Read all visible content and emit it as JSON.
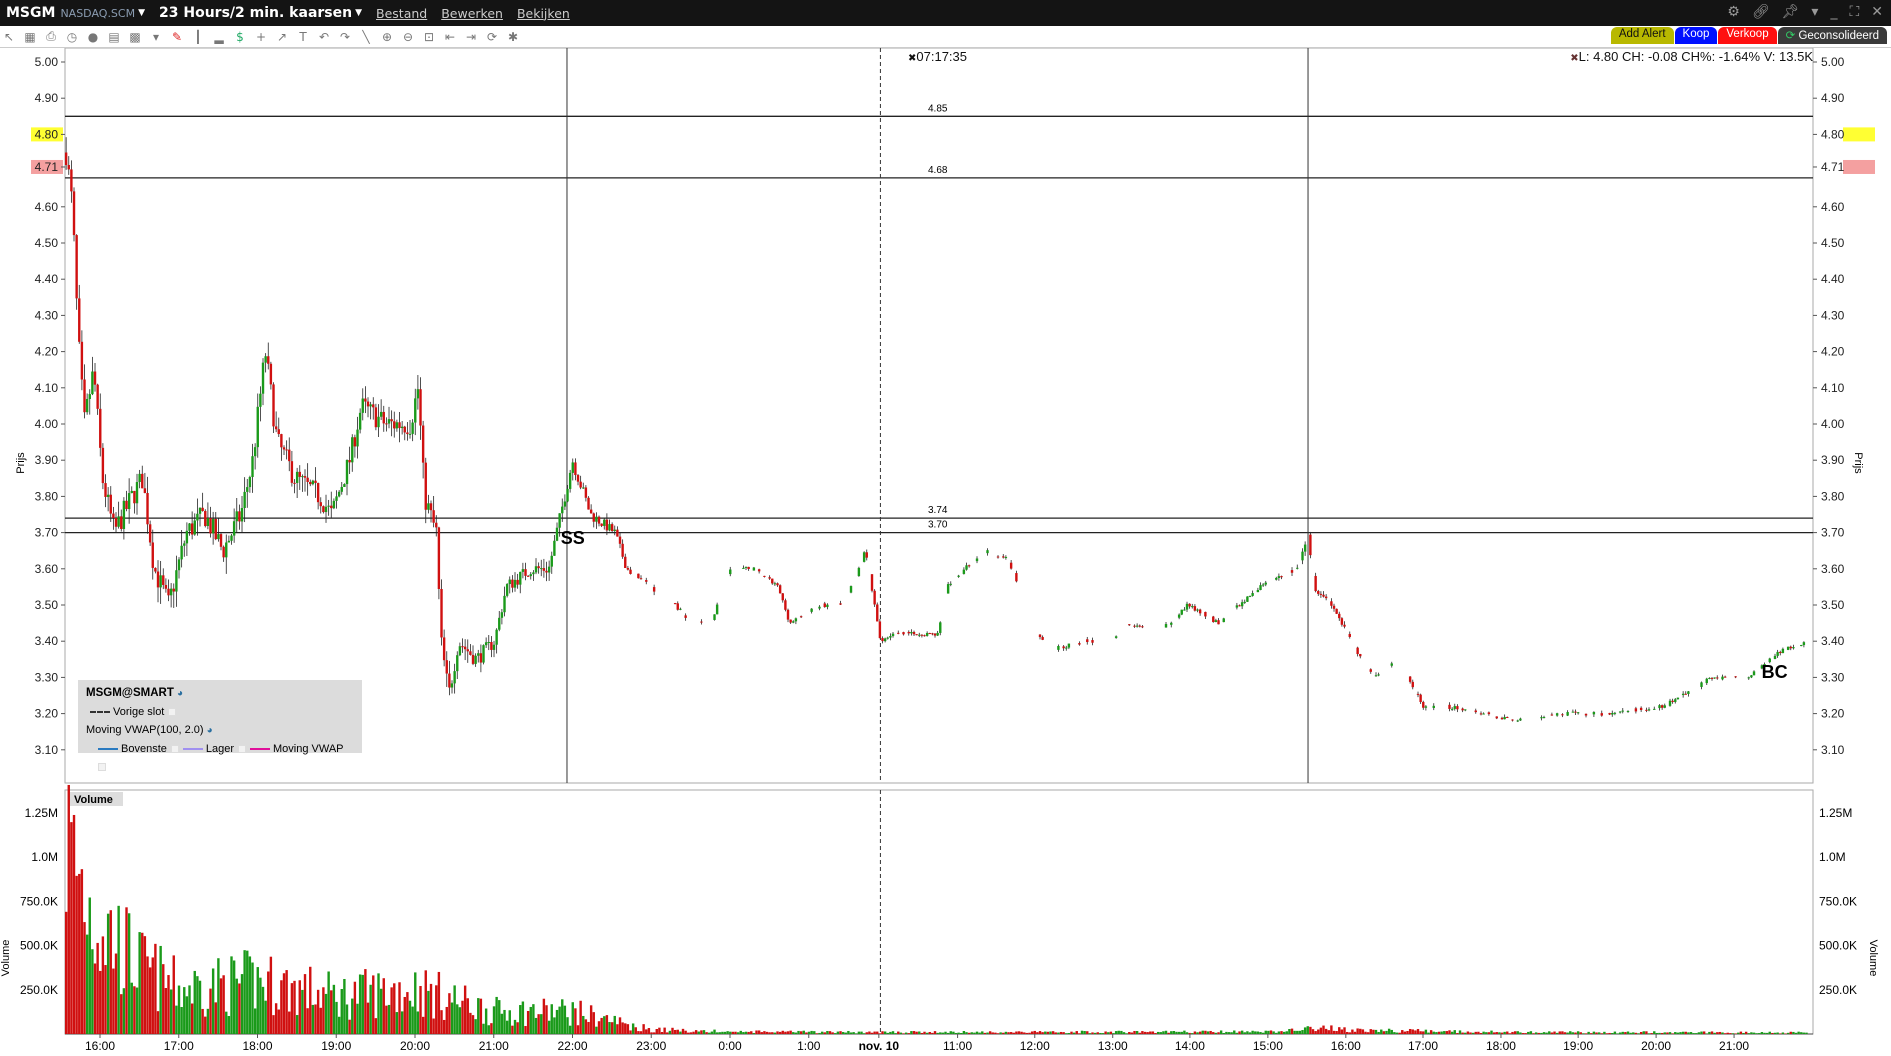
{
  "title_bar": {
    "symbol": "MSGM",
    "exchange": "NASDAQ.SCM",
    "period": "23 Hours/2 min. kaarsen",
    "menus": [
      "Bestand",
      "Bewerken",
      "Bekijken"
    ]
  },
  "actions": {
    "alert": "Add Alert",
    "buy": "Koop",
    "sell": "Verkoop",
    "consolidated": "Geconsolideerd"
  },
  "info": {
    "crosshair_time": "07:17:35",
    "quote": "L: 4.80 CH: -0.08 CH%: -1.64% V: 13.5K"
  },
  "legend": {
    "title": "MSGM@SMART",
    "prev_close": "Vorige slot",
    "indicator": "Moving VWAP(100, 2.0)",
    "upper": "Bovenste",
    "lower": "Lager",
    "vwap": "Moving VWAP"
  },
  "colors": {
    "up": "#1a9a1a",
    "down": "#d01010",
    "last_price_bg": "#ffff33",
    "prev_price_bg": "#f4a0a0",
    "upper": "#2a7ac0",
    "lower": "#a090f0",
    "vwap": "#e0109a"
  },
  "chart_data": {
    "type": "candlestick",
    "price_axis": {
      "label": "Prijs",
      "ylim": [
        3.05,
        5.03
      ],
      "ticks": [
        "5.00",
        "4.90",
        "4.80",
        "4.71",
        "4.60",
        "4.50",
        "4.40",
        "4.30",
        "4.20",
        "4.10",
        "4.00",
        "3.90",
        "3.80",
        "3.70",
        "3.60",
        "3.50",
        "3.40",
        "3.30",
        "3.20",
        "3.10"
      ],
      "highlight_last": "4.80",
      "highlight_prev": "4.71"
    },
    "volume_axis": {
      "label": "Volume",
      "pane_title": "Volume",
      "ticks": [
        "1.25M",
        "1.0M",
        "750.0K",
        "500.0K",
        "250.0K"
      ],
      "tick_values": [
        1250000,
        1000000,
        750000,
        500000,
        250000
      ],
      "ylim": [
        0,
        1320000
      ]
    },
    "time_axis": {
      "labels": [
        [
          "16:00",
          0
        ],
        [
          "17:00",
          1
        ],
        [
          "18:00",
          2
        ],
        [
          "19:00",
          3
        ],
        [
          "20:00",
          4
        ],
        [
          "21:00",
          5
        ],
        [
          "22:00",
          6
        ],
        [
          "23:00",
          7
        ],
        [
          "0:00",
          8
        ],
        [
          "1:00",
          9
        ],
        [
          "nov. 10",
          9.89
        ],
        [
          "11:00",
          10.89
        ],
        [
          "12:00",
          11.87
        ],
        [
          "13:00",
          12.86
        ],
        [
          "14:00",
          13.84
        ],
        [
          "15:00",
          14.83
        ],
        [
          "16:00",
          15.82
        ],
        [
          "17:00",
          16.8
        ],
        [
          "18:00",
          17.79
        ],
        [
          "19:00",
          18.77
        ],
        [
          "20:00",
          19.76
        ],
        [
          "21:00",
          20.75
        ]
      ],
      "xlim": [
        -0.45,
        21.75
      ]
    },
    "hlines": [
      {
        "value": 4.85,
        "label": "4.85"
      },
      {
        "value": 4.68,
        "label": "4.68"
      },
      {
        "value": 3.74,
        "label": "3.74"
      },
      {
        "value": 3.7,
        "label": "3.70"
      }
    ],
    "vlines": [
      {
        "t": 5.93,
        "style": "solid"
      },
      {
        "t": 9.91,
        "style": "dashed"
      },
      {
        "t": 15.34,
        "style": "solid"
      }
    ],
    "annotations": [
      {
        "text": "SS",
        "t": 5.85,
        "price": 3.69
      },
      {
        "text": "BC",
        "t": 21.1,
        "price": 3.32
      }
    ],
    "price_path": [
      [
        -0.43,
        4.75
      ],
      [
        -0.35,
        4.6
      ],
      [
        -0.28,
        4.25
      ],
      [
        -0.2,
        4.0
      ],
      [
        -0.08,
        4.15
      ],
      [
        0.03,
        3.85
      ],
      [
        0.18,
        3.7
      ],
      [
        0.41,
        3.8
      ],
      [
        0.54,
        3.85
      ],
      [
        0.69,
        3.6
      ],
      [
        0.87,
        3.5
      ],
      [
        1.1,
        3.7
      ],
      [
        1.33,
        3.75
      ],
      [
        1.56,
        3.65
      ],
      [
        1.79,
        3.75
      ],
      [
        1.94,
        3.9
      ],
      [
        2.1,
        4.2
      ],
      [
        2.25,
        3.95
      ],
      [
        2.48,
        3.85
      ],
      [
        2.79,
        3.8
      ],
      [
        2.94,
        3.75
      ],
      [
        3.17,
        3.9
      ],
      [
        3.32,
        4.05
      ],
      [
        3.63,
        4.0
      ],
      [
        3.94,
        4.0
      ],
      [
        4.04,
        4.1
      ],
      [
        4.12,
        3.8
      ],
      [
        4.27,
        3.7
      ],
      [
        4.33,
        3.4
      ],
      [
        4.43,
        3.25
      ],
      [
        4.55,
        3.4
      ],
      [
        4.78,
        3.35
      ],
      [
        5.01,
        3.4
      ],
      [
        5.16,
        3.55
      ],
      [
        5.47,
        3.6
      ],
      [
        5.7,
        3.6
      ],
      [
        5.85,
        3.75
      ],
      [
        6.0,
        3.9
      ],
      [
        6.23,
        3.75
      ],
      [
        6.54,
        3.7
      ],
      [
        6.69,
        3.6
      ],
      [
        7.0,
        3.55
      ],
      [
        7.3,
        3.5
      ],
      [
        7.53,
        3.45
      ],
      [
        7.76,
        3.45
      ],
      [
        7.99,
        3.6
      ],
      [
        8.3,
        3.6
      ],
      [
        8.61,
        3.55
      ],
      [
        8.76,
        3.45
      ],
      [
        9.14,
        3.5
      ],
      [
        9.45,
        3.5
      ],
      [
        9.72,
        3.65
      ],
      [
        9.91,
        3.4
      ],
      [
        10.06,
        3.42
      ],
      [
        10.64,
        3.42
      ],
      [
        10.75,
        3.55
      ],
      [
        10.98,
        3.6
      ],
      [
        11.21,
        3.65
      ],
      [
        11.52,
        3.63
      ],
      [
        11.75,
        3.5
      ],
      [
        11.9,
        3.42
      ],
      [
        12.13,
        3.38
      ],
      [
        12.51,
        3.4
      ],
      [
        12.82,
        3.4
      ],
      [
        13.05,
        3.45
      ],
      [
        13.43,
        3.42
      ],
      [
        13.81,
        3.5
      ],
      [
        14.2,
        3.45
      ],
      [
        14.73,
        3.55
      ],
      [
        15.19,
        3.6
      ],
      [
        15.34,
        3.7
      ],
      [
        15.42,
        3.55
      ],
      [
        15.65,
        3.5
      ],
      [
        15.88,
        3.4
      ],
      [
        16.19,
        3.3
      ],
      [
        16.49,
        3.35
      ],
      [
        16.8,
        3.22
      ],
      [
        17.11,
        3.22
      ],
      [
        17.56,
        3.2
      ],
      [
        18.02,
        3.18
      ],
      [
        18.64,
        3.2
      ],
      [
        19.1,
        3.2
      ],
      [
        19.86,
        3.22
      ],
      [
        20.47,
        3.3
      ],
      [
        20.93,
        3.3
      ],
      [
        21.39,
        3.38
      ],
      [
        21.7,
        3.4
      ]
    ],
    "volume_path": [
      [
        -0.43,
        1300000
      ],
      [
        -0.1,
        800000
      ],
      [
        0.5,
        450000
      ],
      [
        1.0,
        300000
      ],
      [
        2.0,
        350000
      ],
      [
        3.0,
        250000
      ],
      [
        4.0,
        300000
      ],
      [
        5.0,
        150000
      ],
      [
        6.0,
        150000
      ],
      [
        7.0,
        30000
      ],
      [
        8.0,
        15000
      ],
      [
        10.0,
        12000
      ],
      [
        15.0,
        15000
      ],
      [
        15.3,
        45000
      ],
      [
        16.0,
        25000
      ],
      [
        18.0,
        12000
      ],
      [
        21.7,
        10000
      ]
    ]
  }
}
